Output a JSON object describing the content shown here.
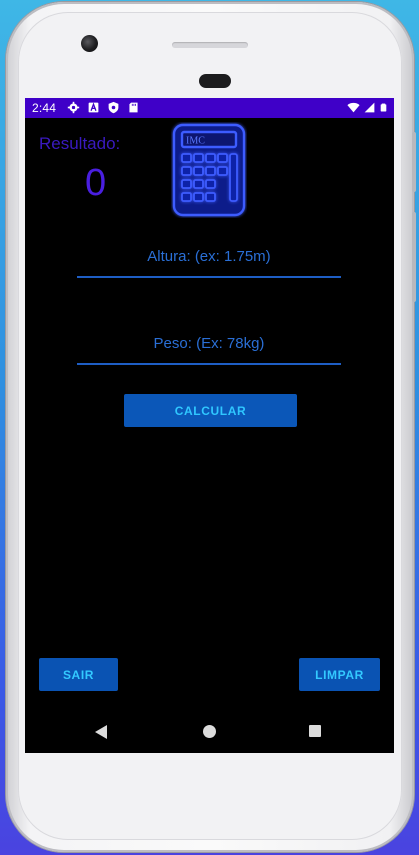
{
  "status_bar": {
    "time": "2:44",
    "left_icons": [
      "gear-icon",
      "font-a-icon",
      "shield-icon",
      "sd-card-icon"
    ],
    "right_icons": [
      "wifi-icon",
      "signal-icon",
      "battery-icon"
    ],
    "background_color": "#3f00c8"
  },
  "main": {
    "result_label": "Resultado:",
    "result_value": "0",
    "app_icon": "imc-calculator-icon",
    "app_icon_text": "IMC",
    "height_input": {
      "placeholder": "Altura: (ex: 1.75m)",
      "value": ""
    },
    "weight_input": {
      "placeholder": "Peso: (Ex: 78kg)",
      "value": ""
    },
    "calculate_label": "CALCULAR"
  },
  "footer": {
    "exit_label": "SAIR",
    "clear_label": "LIMPAR"
  },
  "nav_bar": {
    "icons": [
      "back-icon",
      "home-icon",
      "recents-icon"
    ]
  },
  "colors": {
    "accent_button": "#0b57b8",
    "button_text": "#2fc7ff",
    "result_text": "#4a1fe0",
    "field_line": "#1e5ec4"
  }
}
